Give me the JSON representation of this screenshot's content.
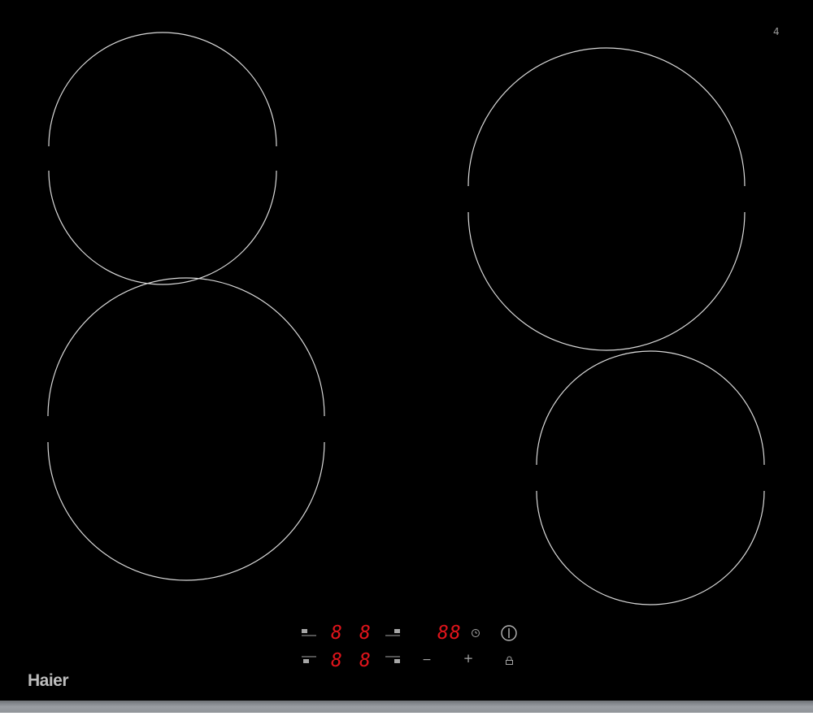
{
  "brand": {
    "name": "Haier"
  },
  "badge": {
    "text": "4"
  },
  "zones": [
    {
      "id": "rear-left",
      "shape": "ring"
    },
    {
      "id": "front-left",
      "shape": "ring"
    },
    {
      "id": "rear-right",
      "shape": "ring"
    },
    {
      "id": "front-right",
      "shape": "ring"
    }
  ],
  "controls": {
    "zone_displays": {
      "rear_left": "8",
      "rear_right": "8",
      "front_left": "8",
      "front_right": "8"
    },
    "timer_display": "88",
    "minus_symbol": "−",
    "plus_symbol": "+",
    "icons": {
      "zone_selectors": "zone-select-icon",
      "timer": "clock-icon",
      "power": "power-icon",
      "lock": "lock-icon"
    }
  },
  "colors": {
    "glass": "#000000",
    "zone_outline": "#d9d9d9",
    "display_red": "#e0141b",
    "control_gray": "#a6a6a6"
  }
}
